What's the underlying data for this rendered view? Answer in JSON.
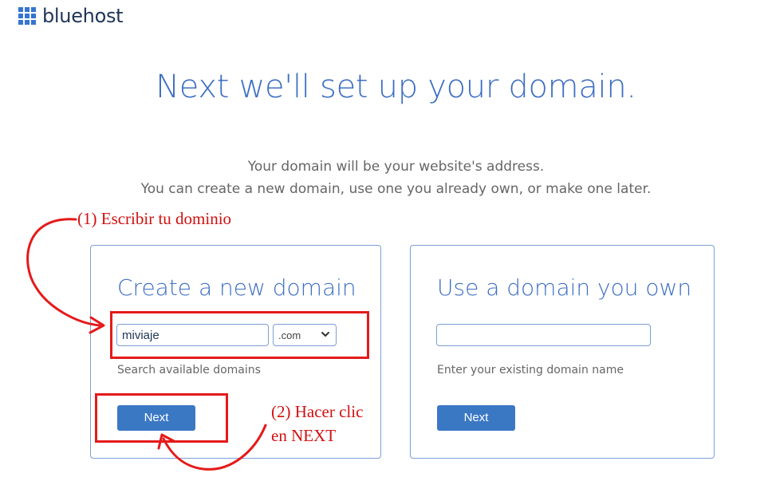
{
  "header": {
    "logo_text": "bluehost"
  },
  "page": {
    "headline": "Next we'll set up your domain.",
    "subline_1": "Your domain will be your website's address.",
    "subline_2": "You can create a new domain, use one you already own, or make one later."
  },
  "new_domain": {
    "title": "Create a new domain",
    "input_value": "miviaje",
    "tld_value": ".com",
    "helper": "Search available domains",
    "button": "Next"
  },
  "own_domain": {
    "title": "Use a domain you own",
    "input_value": "",
    "helper": "Enter your existing domain name",
    "button": "Next"
  },
  "annotations": {
    "step1": "(1) Escribir tu dominio",
    "step2_line1": "(2) Hacer clic",
    "step2_line2": "en NEXT",
    "color": "#e51a1a"
  },
  "colors": {
    "brand_blue": "#3575d3",
    "title_blue": "#3e6fc2",
    "button_blue": "#3a78c4"
  }
}
